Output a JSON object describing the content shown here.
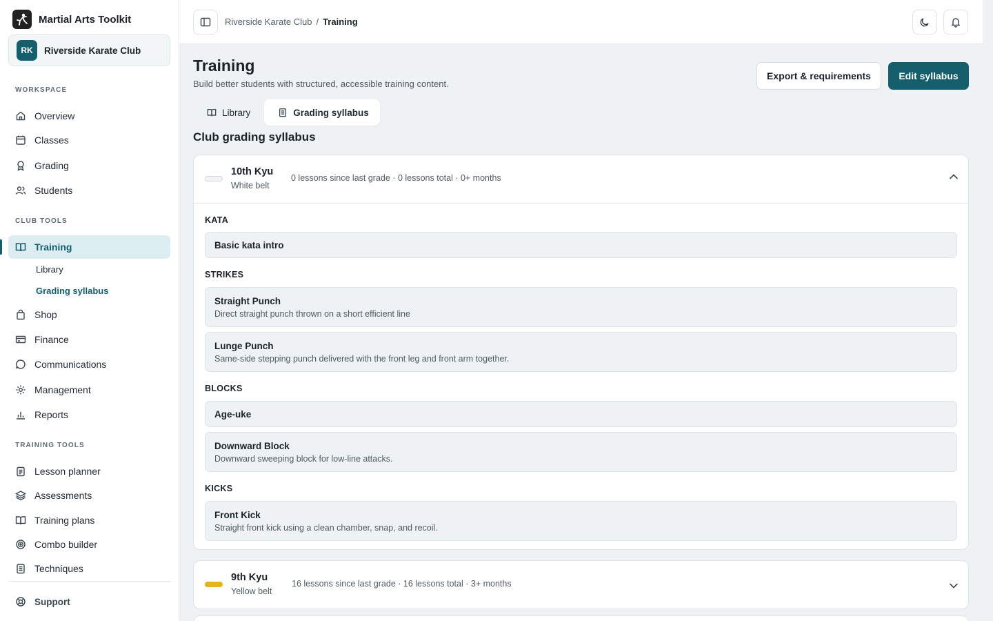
{
  "app": {
    "name": "Martial Arts Toolkit"
  },
  "club": {
    "initials": "RK",
    "name": "Riverside Karate Club"
  },
  "sidebar": {
    "workspace_label": "WORKSPACE",
    "workspace": [
      {
        "label": "Overview",
        "icon": "home-icon"
      },
      {
        "label": "Classes",
        "icon": "calendar-icon"
      },
      {
        "label": "Grading",
        "icon": "ribbon-icon"
      },
      {
        "label": "Students",
        "icon": "users-icon"
      }
    ],
    "club_tools_label": "CLUB TOOLS",
    "training": {
      "label": "Training",
      "icon": "book-open-icon"
    },
    "training_sub": [
      {
        "label": "Library"
      },
      {
        "label": "Grading syllabus"
      }
    ],
    "club_tools": [
      {
        "label": "Shop",
        "icon": "shopping-bag-icon"
      },
      {
        "label": "Finance",
        "icon": "credit-card-icon"
      },
      {
        "label": "Communications",
        "icon": "message-icon"
      },
      {
        "label": "Management",
        "icon": "gear-icon"
      },
      {
        "label": "Reports",
        "icon": "bar-chart-icon"
      }
    ],
    "training_tools_label": "TRAINING TOOLS",
    "training_tools": [
      {
        "label": "Lesson planner",
        "icon": "clipboard-icon"
      },
      {
        "label": "Assessments",
        "icon": "layers-icon"
      },
      {
        "label": "Training plans",
        "icon": "book-icon"
      },
      {
        "label": "Combo builder",
        "icon": "target-icon"
      },
      {
        "label": "Techniques",
        "icon": "document-icon"
      }
    ],
    "support": {
      "label": "Support",
      "icon": "lifebuoy-icon"
    }
  },
  "breadcrumb": {
    "parent": "Riverside Karate Club",
    "separator": "/",
    "current": "Training"
  },
  "page": {
    "title": "Training",
    "subtitle": "Build better students with structured, accessible training content.",
    "export_label": "Export & requirements",
    "edit_label": "Edit syllabus",
    "tabs": [
      {
        "label": "Library",
        "icon": "book-icon"
      },
      {
        "label": "Grading syllabus",
        "icon": "document-icon"
      }
    ],
    "section_heading": "Club grading syllabus"
  },
  "grades": [
    {
      "name": "10th Kyu",
      "belt": "White belt",
      "belt_color": "#f2f4f5",
      "meta": "0 lessons since last grade · 0 lessons total · 0+ months",
      "expanded": true,
      "categories": [
        {
          "label": "KATA",
          "items": [
            {
              "name": "Basic kata intro",
              "desc": ""
            }
          ]
        },
        {
          "label": "STRIKES",
          "items": [
            {
              "name": "Straight Punch",
              "desc": "Direct straight punch thrown on a short efficient line"
            },
            {
              "name": "Lunge Punch",
              "desc": "Same-side stepping punch delivered with the front leg and front arm together."
            }
          ]
        },
        {
          "label": "BLOCKS",
          "items": [
            {
              "name": "Age-uke",
              "desc": ""
            },
            {
              "name": "Downward Block",
              "desc": "Downward sweeping block for low-line attacks."
            }
          ]
        },
        {
          "label": "KICKS",
          "items": [
            {
              "name": "Front Kick",
              "desc": "Straight front kick using a clean chamber, snap, and recoil."
            }
          ]
        }
      ]
    },
    {
      "name": "9th Kyu",
      "belt": "Yellow belt",
      "belt_color": "#e2b51d",
      "meta": "16 lessons since last grade · 16 lessons total · 3+ months",
      "expanded": false
    }
  ],
  "colors": {
    "accent": "#155e6b",
    "accent_soft": "#dcedf1",
    "background": "#eef2f4"
  }
}
